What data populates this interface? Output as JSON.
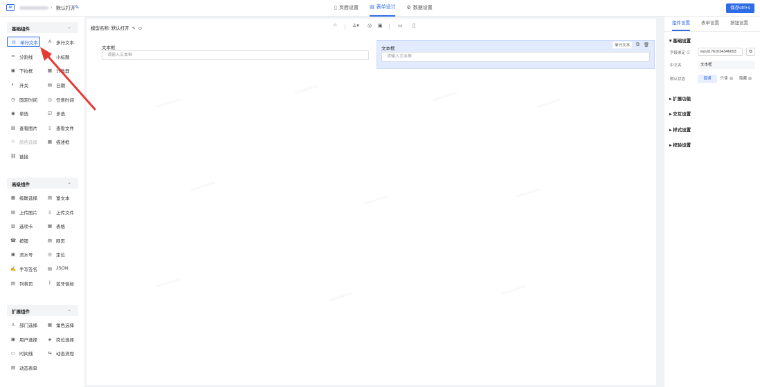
{
  "topbar": {
    "app_icon": "AI",
    "breadcrumb_separator": "›",
    "form_title": "默认打开",
    "tabs": [
      {
        "label": "页面设置",
        "icon": "page-icon"
      },
      {
        "label": "表单设计",
        "icon": "form-icon"
      },
      {
        "label": "数据设置",
        "icon": "data-settings-icon"
      }
    ],
    "active_tab": "表单设计",
    "save_label": "保存ctrl+s"
  },
  "left_panel": {
    "basic_group": {
      "title": "基础组件",
      "items": [
        {
          "label": "单行文本",
          "icon": "text-input-icon"
        },
        {
          "label": "多行文本",
          "icon": "textarea-icon"
        },
        {
          "label": "分割线",
          "icon": "divider-icon"
        },
        {
          "label": "小标题",
          "icon": "subtitle-icon"
        },
        {
          "label": "下拉框",
          "icon": "dropdown-icon"
        },
        {
          "label": "计数器",
          "icon": "counter-icon"
        },
        {
          "label": "开关",
          "icon": "switch-icon"
        },
        {
          "label": "日期",
          "icon": "date-icon"
        },
        {
          "label": "固定时间",
          "icon": "clock-icon"
        },
        {
          "label": "任意时间",
          "icon": "time-icon"
        },
        {
          "label": "单选",
          "icon": "radio-icon"
        },
        {
          "label": "多选",
          "icon": "checkbox-icon"
        },
        {
          "label": "查看图片",
          "icon": "image-icon"
        },
        {
          "label": "查看文件",
          "icon": "file-icon"
        },
        {
          "label": "颜色选择",
          "icon": "color-icon"
        },
        {
          "label": "描述框",
          "icon": "description-icon"
        },
        {
          "label": "链接",
          "icon": "link-icon"
        }
      ]
    },
    "advanced_group": {
      "title": "高级组件",
      "items": [
        {
          "label": "级联选择",
          "icon": "cascader-icon"
        },
        {
          "label": "富文本",
          "icon": "rich-text-icon"
        },
        {
          "label": "上传图片",
          "icon": "upload-image-icon"
        },
        {
          "label": "上传文件",
          "icon": "upload-file-icon"
        },
        {
          "label": "选项卡",
          "icon": "tabs-icon"
        },
        {
          "label": "表格",
          "icon": "table-icon"
        },
        {
          "label": "按钮",
          "icon": "button-icon"
        },
        {
          "label": "网页",
          "icon": "webpage-icon"
        },
        {
          "label": "流水号",
          "icon": "serial-number-icon"
        },
        {
          "label": "定位",
          "icon": "location-icon"
        },
        {
          "label": "手写签名",
          "icon": "signature-icon"
        },
        {
          "label": "JSON",
          "icon": "json-icon"
        },
        {
          "label": "列表页",
          "icon": "list-page-icon"
        },
        {
          "label": "蓝牙俱标",
          "icon": "bluetooth-icon"
        }
      ]
    },
    "extended_group": {
      "title": "扩展组件",
      "items": [
        {
          "label": "部门选择",
          "icon": "department-icon"
        },
        {
          "label": "角色选择",
          "icon": "role-icon"
        },
        {
          "label": "用户选择",
          "icon": "user-icon"
        },
        {
          "label": "岗位选择",
          "icon": "position-icon"
        },
        {
          "label": "时间线",
          "icon": "timeline-icon"
        },
        {
          "label": "动态流程",
          "icon": "flow-icon"
        },
        {
          "label": "动态表单",
          "icon": "dynamic-form-icon"
        }
      ]
    }
  },
  "canvas": {
    "model_name_label": "模型名称:",
    "model_name_value": "默认打开",
    "fields": [
      {
        "label": "文本框",
        "placeholder": "请输入文本框"
      },
      {
        "label": "文本框",
        "placeholder": "请输入文本框"
      }
    ],
    "selected_tag": "单行文本"
  },
  "right_panel": {
    "tabs": [
      "组件设置",
      "表单设置",
      "按钮设置"
    ],
    "active_tab": "组件设置",
    "basic_section": "基础设置",
    "field_id_label": "字段绑定",
    "field_id_value": "input1761034346653",
    "cn_label": "中文名",
    "cn_value": "文本框",
    "status_label": "默认状态",
    "status_options": [
      "普通",
      "只读",
      "隐藏"
    ],
    "active_status": "普通",
    "sections": [
      "扩展功能",
      "交互设置",
      "样式设置",
      "校验设置"
    ]
  },
  "colors": {
    "accent": "#2e6be6",
    "selected_bg": "#e2ebfd",
    "annotation_arrow": "#e53935"
  }
}
